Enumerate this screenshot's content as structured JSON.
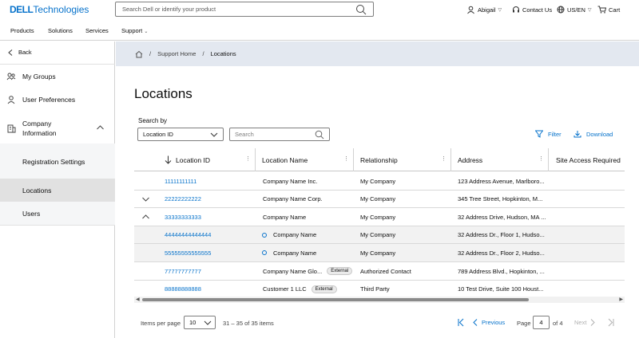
{
  "header": {
    "logo_dell": "DELL",
    "logo_tech": "Technologies",
    "search_placeholder": "Search Dell or identify your product",
    "user": "Abigail",
    "contact": "Contact Us",
    "locale": "US/EN",
    "cart": "Cart"
  },
  "nav": {
    "items": [
      "Products",
      "Solutions",
      "Services",
      "Support"
    ]
  },
  "sidebar": {
    "back": "Back",
    "items": [
      {
        "label": "My Groups",
        "icon": "groups-icon"
      },
      {
        "label": "User Preferences",
        "icon": "user-icon"
      },
      {
        "label": "Company Information",
        "icon": "building-icon"
      }
    ],
    "subitems": [
      "Registration Settings",
      "Locations",
      "Users"
    ],
    "active": "Locations"
  },
  "breadcrumb": {
    "items": [
      "Support Home",
      "Locations"
    ]
  },
  "page": {
    "title": "Locations",
    "search_by_label": "Search by",
    "search_by_value": "Location ID",
    "search_placeholder": "Search",
    "filter_label": "Filter",
    "download_label": "Download"
  },
  "table": {
    "columns": [
      "Location ID",
      "Location Name",
      "Relationship",
      "Address",
      "Site Access Required"
    ],
    "rows": [
      {
        "id": "11111111111",
        "name": "Company Name Inc.",
        "tag": "",
        "relationship": "My Company",
        "address": "123 Address Avenue, Marlboro...",
        "expand": "",
        "sub": false
      },
      {
        "id": "22222222222",
        "name": "Company Name Corp.",
        "tag": "",
        "relationship": "My Company",
        "address": "345 Tree Street, Hopkinton, M...",
        "expand": "down",
        "sub": false
      },
      {
        "id": "33333333333",
        "name": "Company Name",
        "tag": "",
        "relationship": "My Company",
        "address": "32 Address Drive, Hudson, MA ...",
        "expand": "up",
        "sub": false
      },
      {
        "id": "44444444444444",
        "name": "Company Name",
        "tag": "",
        "relationship": "My Company",
        "address": "32 Address Dr., Floor 1, Hudso...",
        "expand": "",
        "sub": true
      },
      {
        "id": "55555555555555",
        "name": "Company Name",
        "tag": "",
        "relationship": "My Company",
        "address": "32 Address Dr., Floor 2, Hudso...",
        "expand": "",
        "sub": true
      },
      {
        "id": "77777777777",
        "name": "Company Name Glo...",
        "tag": "External",
        "relationship": "Authorized Contact",
        "address": "789 Address Blvd., Hopkinton, ...",
        "expand": "",
        "sub": false
      },
      {
        "id": "88888888888",
        "name": "Customer 1 LLC",
        "tag": "External",
        "relationship": "Third Party",
        "address": "10 Test Drive, Suite 100 Houst...",
        "expand": "",
        "sub": false
      }
    ]
  },
  "pagination": {
    "items_per_page_label": "Items per page",
    "items_per_page": "10",
    "range": "31 – 35 of 35 items",
    "previous": "Previous",
    "page_label": "Page",
    "page": "4",
    "of": "of 4",
    "next": "Next"
  },
  "colors": {
    "accent": "#0672cb",
    "crumb_bg": "#e3e8f0",
    "active_bg": "#e1e1e1"
  }
}
